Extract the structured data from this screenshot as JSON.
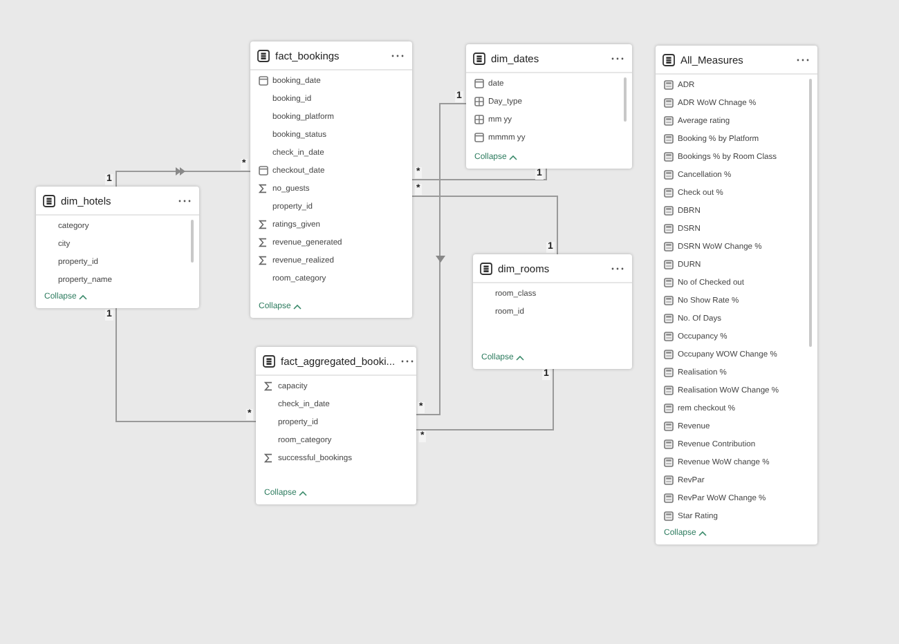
{
  "tables": [
    {
      "name": "fact_bookings",
      "scrollbar": false,
      "collapse": "Collapse",
      "fields": [
        {
          "name": "booking_date",
          "kind": "date"
        },
        {
          "name": "booking_id",
          "kind": "plain"
        },
        {
          "name": "booking_platform",
          "kind": "plain"
        },
        {
          "name": "booking_status",
          "kind": "plain"
        },
        {
          "name": "check_in_date",
          "kind": "plain"
        },
        {
          "name": "checkout_date",
          "kind": "date"
        },
        {
          "name": "no_guests",
          "kind": "sum"
        },
        {
          "name": "property_id",
          "kind": "plain"
        },
        {
          "name": "ratings_given",
          "kind": "sum"
        },
        {
          "name": "revenue_generated",
          "kind": "sum"
        },
        {
          "name": "revenue_realized",
          "kind": "sum"
        },
        {
          "name": "room_category",
          "kind": "plain"
        }
      ]
    },
    {
      "name": "dim_hotels",
      "scrollbar": true,
      "collapse": "Collapse",
      "fields": [
        {
          "name": "category",
          "kind": "plain"
        },
        {
          "name": "city",
          "kind": "plain"
        },
        {
          "name": "property_id",
          "kind": "plain"
        },
        {
          "name": "property_name",
          "kind": "plain"
        }
      ]
    },
    {
      "name": "dim_dates",
      "scrollbar": true,
      "collapse": "Collapse",
      "fields": [
        {
          "name": "date",
          "kind": "date"
        },
        {
          "name": "Day_type",
          "kind": "calc"
        },
        {
          "name": "mm yy",
          "kind": "calc"
        },
        {
          "name": "mmmm yy",
          "kind": "date"
        }
      ]
    },
    {
      "name": "dim_rooms",
      "scrollbar": false,
      "collapse": "Collapse",
      "fields": [
        {
          "name": "room_class",
          "kind": "plain"
        },
        {
          "name": "room_id",
          "kind": "plain"
        }
      ]
    },
    {
      "name": "fact_aggregated_booki...",
      "scrollbar": false,
      "collapse": "Collapse",
      "fields": [
        {
          "name": "capacity",
          "kind": "sum"
        },
        {
          "name": "check_in_date",
          "kind": "plain"
        },
        {
          "name": "property_id",
          "kind": "plain"
        },
        {
          "name": "room_category",
          "kind": "plain"
        },
        {
          "name": "successful_bookings",
          "kind": "sum"
        }
      ]
    },
    {
      "name": "All_Measures",
      "scrollbar": true,
      "collapse": "Collapse",
      "fields": [
        {
          "name": "ADR",
          "kind": "measure"
        },
        {
          "name": "ADR WoW Chnage %",
          "kind": "measure"
        },
        {
          "name": "Average rating",
          "kind": "measure"
        },
        {
          "name": "Booking % by Platform",
          "kind": "measure"
        },
        {
          "name": "Bookings % by Room Class",
          "kind": "measure"
        },
        {
          "name": "Cancellation %",
          "kind": "measure"
        },
        {
          "name": "Check out %",
          "kind": "measure"
        },
        {
          "name": "DBRN",
          "kind": "measure"
        },
        {
          "name": "DSRN",
          "kind": "measure"
        },
        {
          "name": "DSRN WoW Change %",
          "kind": "measure"
        },
        {
          "name": "DURN",
          "kind": "measure"
        },
        {
          "name": "No of Checked out",
          "kind": "measure"
        },
        {
          "name": "No Show Rate %",
          "kind": "measure"
        },
        {
          "name": "No. Of Days",
          "kind": "measure"
        },
        {
          "name": "Occupancy %",
          "kind": "measure"
        },
        {
          "name": "Occupany WOW Change %",
          "kind": "measure"
        },
        {
          "name": "Realisation %",
          "kind": "measure"
        },
        {
          "name": "Realisation WoW Change %",
          "kind": "measure"
        },
        {
          "name": "rem checkout %",
          "kind": "measure"
        },
        {
          "name": "Revenue",
          "kind": "measure"
        },
        {
          "name": "Revenue Contribution",
          "kind": "measure"
        },
        {
          "name": "Revenue WoW change %",
          "kind": "measure"
        },
        {
          "name": "RevPar",
          "kind": "measure"
        },
        {
          "name": "RevPar WoW Change %",
          "kind": "measure"
        },
        {
          "name": "Star Rating",
          "kind": "measure"
        }
      ]
    }
  ],
  "relationships": [
    {
      "kind": "rightward",
      "from_card": "1",
      "to_card": "*"
    },
    {
      "kind": "plain",
      "from_card": "1",
      "to_card": "*"
    },
    {
      "kind": "downward",
      "from_card": "1",
      "to_card": "*"
    },
    {
      "kind": "plain",
      "from_card": "1",
      "to_card": "*"
    },
    {
      "kind": "plain",
      "from_card": "*",
      "to_card": "1"
    },
    {
      "kind": "plain",
      "from_card": "1",
      "to_card": "*"
    }
  ]
}
